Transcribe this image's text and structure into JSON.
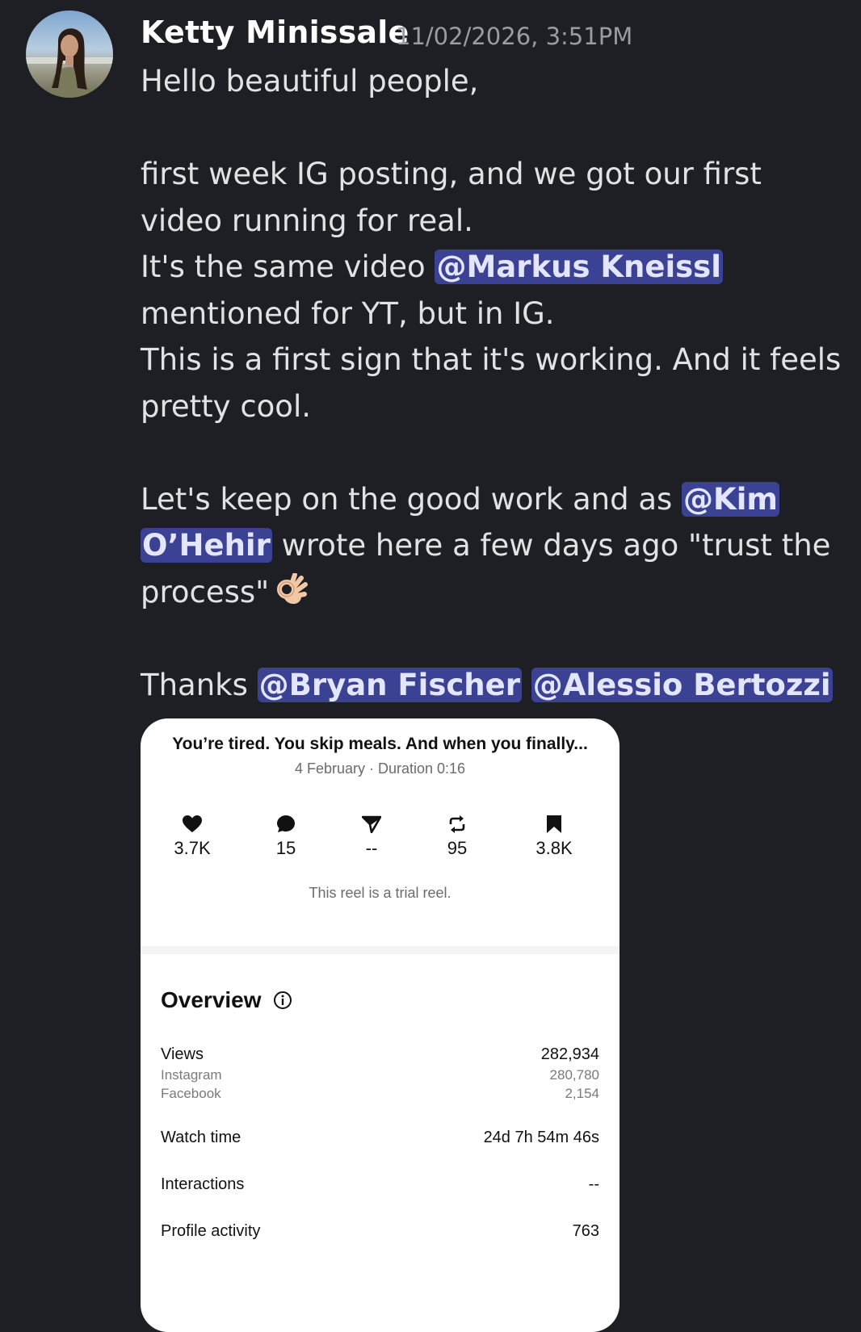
{
  "author": {
    "name": "Ketty Minissale",
    "timestamp": "11/02/2026, 3:51PM"
  },
  "message": {
    "greeting": "Hello beautiful people,",
    "p1_l1": "first week IG posting, and we got our first",
    "p1_l2": "video running for real.",
    "p1_l3_pre": "It's the same video ",
    "mention_markus": "@Markus Kneissl",
    "p1_l4": "mentioned for YT, but in IG.",
    "p1_l5": "This is a first sign that it's working. And it feels",
    "p1_l6": "pretty cool.",
    "p2_l1_pre": "Let's keep on the good work and as ",
    "mention_kim_1": "@Kim",
    "mention_kim_2": "O’Hehir",
    "p2_l2_post": " wrote here a few days ago \"trust the",
    "p2_l3": "process\"",
    "emoji": "ok-hand-emoji",
    "p3_pre": "Thanks ",
    "mention_bryan": "@Bryan Fischer",
    "mention_alessio": "@Alessio Bertozzi"
  },
  "reel": {
    "title": "You’re tired. You skip meals. And when you finally...",
    "subtitle": "4 February · Duration 0:16",
    "stats": [
      {
        "icon": "heart-icon",
        "value": "3.7K"
      },
      {
        "icon": "comment-icon",
        "value": "15"
      },
      {
        "icon": "share-icon",
        "value": "--"
      },
      {
        "icon": "repost-icon",
        "value": "95"
      },
      {
        "icon": "bookmark-icon",
        "value": "3.8K"
      }
    ],
    "trial_note": "This reel is a trial reel.",
    "overview_title": "Overview",
    "views_label": "Views",
    "views_value": "282,934",
    "instagram_label": "Instagram",
    "instagram_value": "280,780",
    "facebook_label": "Facebook",
    "facebook_value": "2,154",
    "watch_label": "Watch time",
    "watch_value": "24d 7h 54m 46s",
    "interactions_label": "Interactions",
    "interactions_value": "--",
    "profile_label": "Profile activity",
    "profile_value": "763"
  },
  "colors": {
    "background": "#1e1f24",
    "mention_bg": "#3c4293",
    "card_bg": "#ffffff"
  }
}
